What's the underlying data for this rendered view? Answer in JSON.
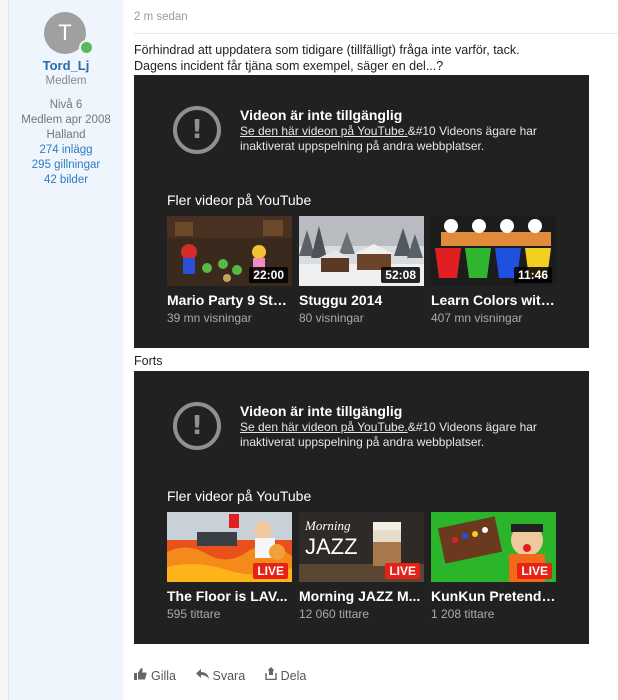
{
  "user": {
    "avatar_initial": "T",
    "name": "Tord_Lj",
    "title": "Medlem",
    "level": "Nivå 6",
    "member_since": "Medlem apr 2008",
    "location": "Halland",
    "posts": "274 inlägg",
    "likes": "295 gillningar",
    "images": "42 bilder",
    "online_color": "#5cb85c"
  },
  "post": {
    "timestamp": "2 m sedan",
    "text_line1": "Förhindrad att uppdatera som tidigare (tillfälligt) fråga inte varför, tack.",
    "text_line2": "Dagens incident får tjäna som exempel, säger en del...?",
    "forts": "Forts"
  },
  "embeds": [
    {
      "error_title": "Videon är inte tillgänglig",
      "error_link": "Se den här videon på YouTube.",
      "error_rest": "&#10 Videons ägare har inaktiverat uppspelning på andra webbplatser.",
      "more_title": "Fler videor på YouTube",
      "videos": [
        {
          "title": "Mario Party 9 Ste...",
          "meta": "39 mn visningar",
          "badge": "22:00"
        },
        {
          "title": "Stuggu 2014",
          "meta": "80 visningar",
          "badge": "52:08"
        },
        {
          "title": "Learn Colors with...",
          "meta": "407 mn visningar",
          "badge": "11:46"
        }
      ]
    },
    {
      "error_title": "Videon är inte tillgänglig",
      "error_link": "Se den här videon på YouTube.",
      "error_rest": "&#10 Videons ägare har inaktiverat uppspelning på andra webbplatser.",
      "more_title": "Fler videor på YouTube",
      "videos": [
        {
          "title": "The Floor is LAV...",
          "meta": "595 tittare",
          "badge": "LIVE"
        },
        {
          "title": "Morning JAZZ M...",
          "meta": "12 060 tittare",
          "badge": "LIVE",
          "thumb_text_1": "Morning",
          "thumb_text_2": "JAZZ"
        },
        {
          "title": "KunKun Pretend ...",
          "meta": "1 208 tittare",
          "badge": "LIVE"
        }
      ]
    }
  ],
  "actions": {
    "like": "Gilla",
    "reply": "Svara",
    "share": "Dela"
  },
  "icons": {
    "error": "exclamation-circle-icon",
    "like": "thumbs-up-icon",
    "reply": "reply-arrow-icon",
    "share": "share-icon"
  }
}
